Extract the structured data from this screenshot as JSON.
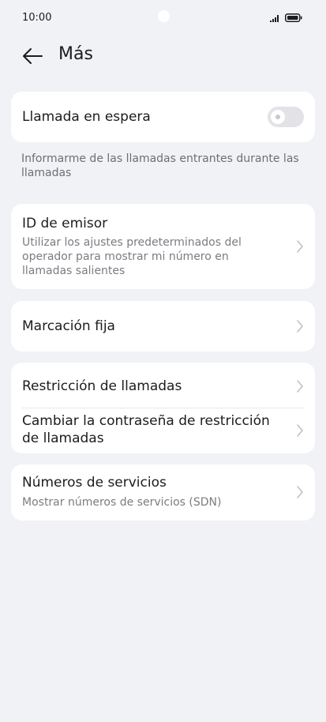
{
  "status_bar": {
    "time": "10:00"
  },
  "header": {
    "title": "Más"
  },
  "call_waiting": {
    "label": "Llamada en espera",
    "toggle_on": false,
    "note": "Informarme de las llamadas entrantes durante las llamadas"
  },
  "caller_id": {
    "label": "ID de emisor",
    "sub": "Utilizar los ajustes predeterminados del operador para mostrar mi número en llamadas salientes"
  },
  "fixed_dialing": {
    "label": "Marcación fija"
  },
  "call_barring": {
    "restriction_label": "Restricción de llamadas",
    "change_password_label": "Cambiar la contraseña de restricción de llamadas"
  },
  "service_numbers": {
    "label": "Números de servicios",
    "sub": "Mostrar números de servicios (SDN)"
  },
  "colors": {
    "background": "#f1f2f6",
    "card": "#ffffff",
    "chevron": "#c2c2c6"
  }
}
